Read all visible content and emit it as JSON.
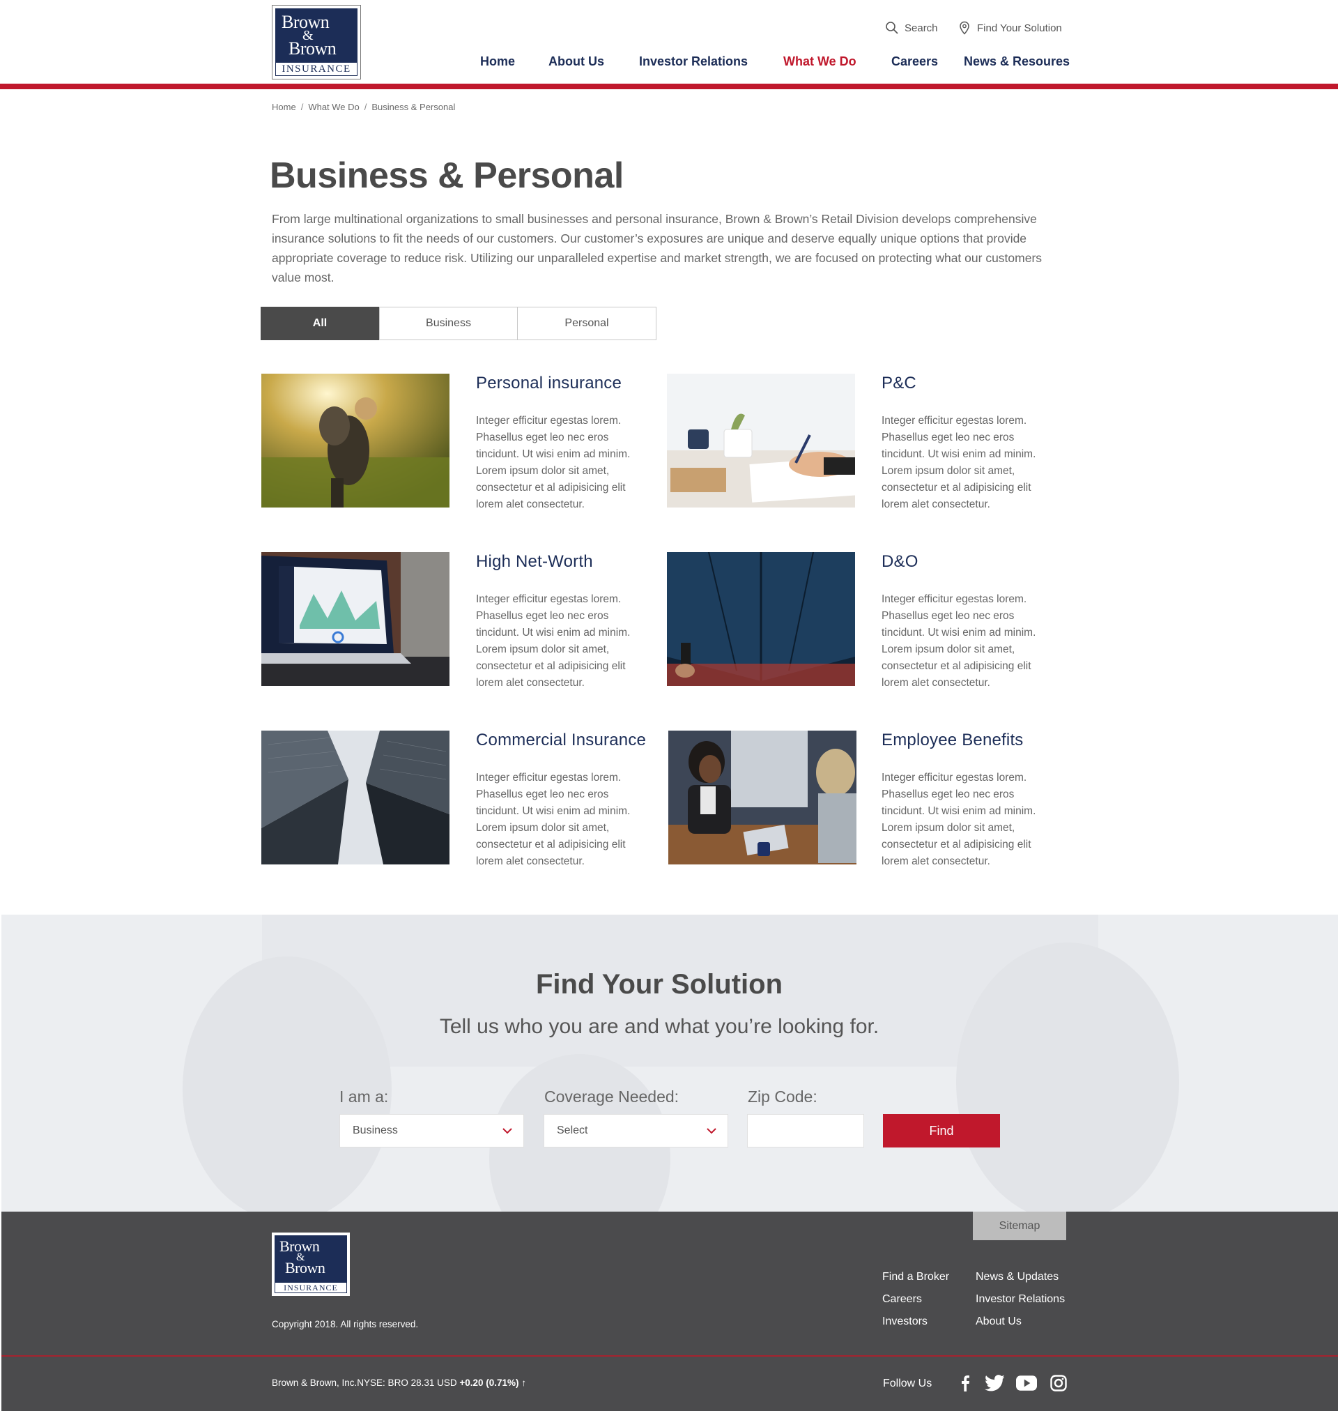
{
  "brand": {
    "logo_line1": "Brown",
    "logo_amp": "&",
    "logo_line2": "Brown",
    "logo_sub": "INSURANCE"
  },
  "utility": {
    "search_label": "Search",
    "find_label": "Find Your Solution"
  },
  "nav": {
    "items": [
      "Home",
      "About Us",
      "Investor Relations",
      "What We Do",
      "Careers",
      "News & Resoures"
    ],
    "active": "What We Do"
  },
  "breadcrumb": [
    "Home",
    "What We Do",
    "Business & Personal"
  ],
  "page": {
    "title": "Business & Personal",
    "intro": "From large multinational organizations to small businesses and personal insurance, Brown & Brown’s Retail Division develops comprehensive insurance solutions to fit the needs of our customers. Our customer’s exposures are unique and deserve equally unique options that provide appropriate coverage to reduce risk. Utilizing our unparalleled expertise and market strength, we are focused on protecting what our customers value most."
  },
  "filters": {
    "tabs": [
      "All",
      "Business",
      "Personal"
    ],
    "active": "All"
  },
  "cards": [
    {
      "title": "Personal insurance",
      "text": "Integer efficitur egestas lorem. Phasellus eget leo nec eros tincidunt. Ut wisi enim ad minim. Lorem ipsum dolor sit amet, consectetur et al adipisicing elit lorem alet consectetur."
    },
    {
      "title": "P&C",
      "text": "Integer efficitur egestas lorem. Phasellus eget leo nec eros tincidunt. Ut wisi enim ad minim. Lorem ipsum dolor sit amet, consectetur et al adipisicing elit lorem alet consectetur."
    },
    {
      "title": "High Net-Worth",
      "text": "Integer efficitur egestas lorem. Phasellus eget leo nec eros tincidunt. Ut wisi enim ad minim. Lorem ipsum dolor sit amet, consectetur et al adipisicing elit lorem alet consectetur."
    },
    {
      "title": "D&O",
      "text": "Integer efficitur egestas lorem. Phasellus eget leo nec eros tincidunt. Ut wisi enim ad minim. Lorem ipsum dolor sit amet, consectetur et al adipisicing elit lorem alet consectetur."
    },
    {
      "title": "Commercial Insurance",
      "text": "Integer efficitur egestas lorem. Phasellus eget leo nec eros tincidunt. Ut wisi enim ad minim. Lorem ipsum dolor sit amet, consectetur et al adipisicing elit lorem alet consectetur."
    },
    {
      "title": "Employee Benefits",
      "text": "Integer efficitur egestas lorem. Phasellus eget leo nec eros tincidunt. Ut wisi enim ad minim. Lorem ipsum dolor sit amet, consectetur et al adipisicing elit lorem alet consectetur."
    }
  ],
  "find": {
    "title": "Find Your Solution",
    "subtitle": "Tell us who you are and what you’re looking for.",
    "i_am_label": "I am a:",
    "i_am_value": "Business",
    "coverage_label": "Coverage Needed:",
    "coverage_value": "Select",
    "zip_label": "Zip Code:",
    "zip_value": "",
    "button": "Find"
  },
  "footer": {
    "sitemap": "Sitemap",
    "copyright": "Copyright 2018. All rights reserved.",
    "links_col1": [
      "Find a Broker",
      "Careers",
      "Investors"
    ],
    "links_col2": [
      "News & Updates",
      "Investor Relations",
      "About Us"
    ],
    "stock_prefix": "Brown & Brown, Inc.NYSE: BRO 28.31 USD",
    "stock_change": "+0.20 (0.71%)",
    "follow_label": "Follow Us",
    "social_icons": [
      "facebook-icon",
      "twitter-icon",
      "youtube-icon",
      "instagram-icon"
    ]
  },
  "colors": {
    "brand_navy": "#1c2d57",
    "brand_red": "#c0182c",
    "footer_gray": "#4b4b4d",
    "active_tab": "#4a4a4a"
  }
}
